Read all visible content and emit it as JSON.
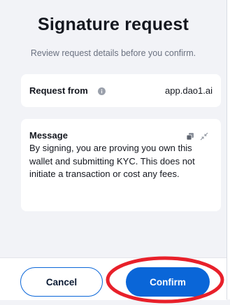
{
  "header": {
    "title": "Signature request",
    "subtitle": "Review request details before you confirm."
  },
  "request": {
    "label": "Request from",
    "value": "app.dao1.ai",
    "info_icon": "info-icon"
  },
  "message": {
    "label": "Message",
    "body": "By signing, you are proving you own this wallet and submitting KYC. This does not initiate a transaction or cost any fees.",
    "copy_icon": "copy-icon",
    "collapse_icon": "collapse-icon"
  },
  "footer": {
    "cancel_label": "Cancel",
    "confirm_label": "Confirm"
  },
  "colors": {
    "accent": "#0a66d8",
    "highlight": "#e8202a",
    "background": "#f2f3f7"
  }
}
